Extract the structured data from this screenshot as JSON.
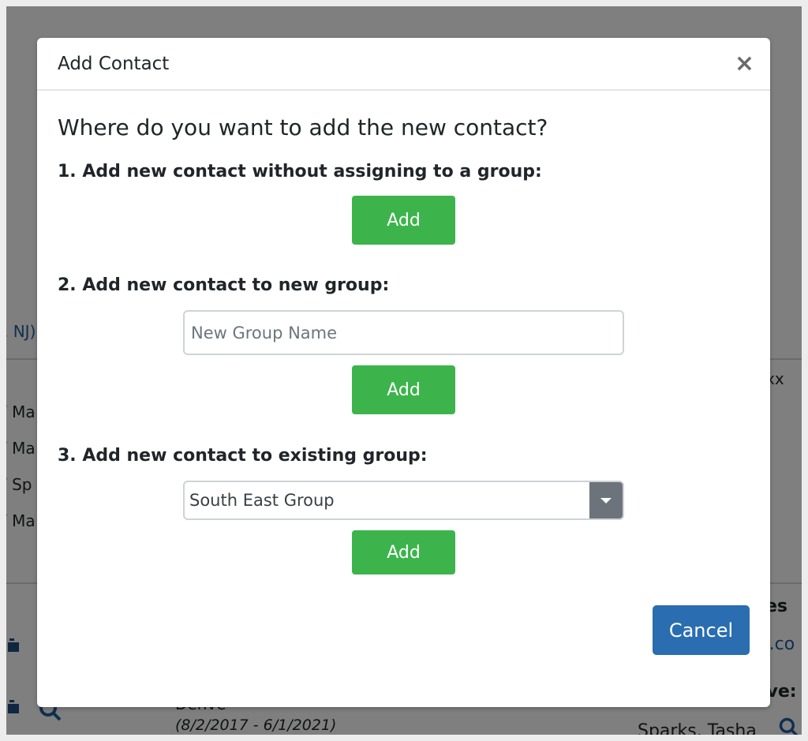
{
  "background": {
    "left_link": ", NJ)",
    "left_items": [
      "/ Ma",
      "/ Ma",
      "/ Sp",
      "/ Ma"
    ],
    "right_text_xx": "xx",
    "right_heading_1": "es",
    "right_link": "t.co",
    "right_heading_2": "ive:",
    "bottom_truncated": "Denve",
    "date_range": "(8/2/2017 - 6/1/2021)",
    "person_name": "Sparks, Tasha",
    "colors": {
      "link": "#1f5f9e",
      "backdrop": "#808080"
    }
  },
  "modal": {
    "title": "Add Contact",
    "close_label": "×",
    "question": "Where do you want to add the new contact?",
    "option1": {
      "label": "1. Add new contact without assigning to a group:",
      "button_label": "Add"
    },
    "option2": {
      "label": "2. Add new contact to new group:",
      "input_placeholder": "New Group Name",
      "input_value": "",
      "button_label": "Add"
    },
    "option3": {
      "label": "3. Add new contact to existing group:",
      "selected_group": "South East Group",
      "button_label": "Add"
    },
    "cancel_label": "Cancel",
    "colors": {
      "add": "#3cb44b",
      "cancel": "#2a6db1",
      "select_arrow": "#6c737b"
    }
  }
}
